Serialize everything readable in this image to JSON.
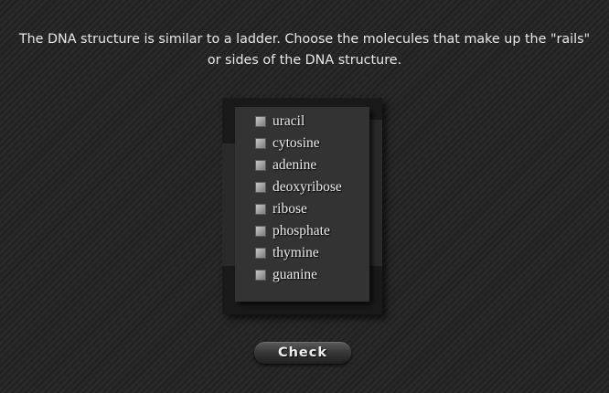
{
  "question": {
    "line1": "The DNA structure is similar to a ladder. Choose the molecules that make up the \"rails\"",
    "line2": "or sides of the DNA structure."
  },
  "options": [
    {
      "label": "uracil",
      "checked": false
    },
    {
      "label": "cytosine",
      "checked": false
    },
    {
      "label": "adenine",
      "checked": false
    },
    {
      "label": "deoxyribose",
      "checked": false
    },
    {
      "label": "ribose",
      "checked": false
    },
    {
      "label": "phosphate",
      "checked": false
    },
    {
      "label": "thymine",
      "checked": false
    },
    {
      "label": "guanine",
      "checked": false
    }
  ],
  "check_button": {
    "label": "Check"
  }
}
